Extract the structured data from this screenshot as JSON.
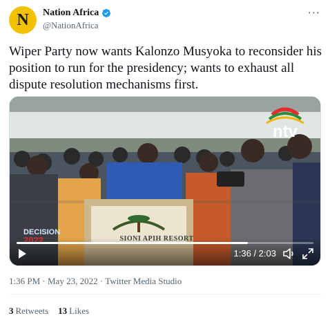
{
  "account": {
    "avatar_letter": "N",
    "display_name": "Nation Africa",
    "handle": "@NationAfrica",
    "more_glyph": "···"
  },
  "tweet": {
    "text": "Wiper Party now wants Kalonzo Musyoka to reconsider his position to run for the presidency; wants to exhaust all dispute resolution mechanisms first."
  },
  "media": {
    "time_display": "1:36 / 2:03",
    "progress_fraction": 0.78,
    "podium_sign": "SIONI APIH RESORT",
    "channel_logo": "ntv",
    "badge_top": "DECISION",
    "badge_year": "2022"
  },
  "meta": {
    "time": "1:36 PM",
    "separator": " · ",
    "date": "May 23, 2022",
    "source": "Twitter Media Studio"
  },
  "stats": {
    "retweets_count": "3",
    "retweets_label": "Retweets",
    "likes_count": "13",
    "likes_label": "Likes"
  },
  "colors": {
    "verified": "#1d9bf0",
    "avatar_bg": "#f2c200",
    "muted_text": "#536471"
  },
  "icons": [
    "verified-badge-icon",
    "more-icon",
    "play-icon",
    "volume-icon",
    "fullscreen-icon"
  ]
}
